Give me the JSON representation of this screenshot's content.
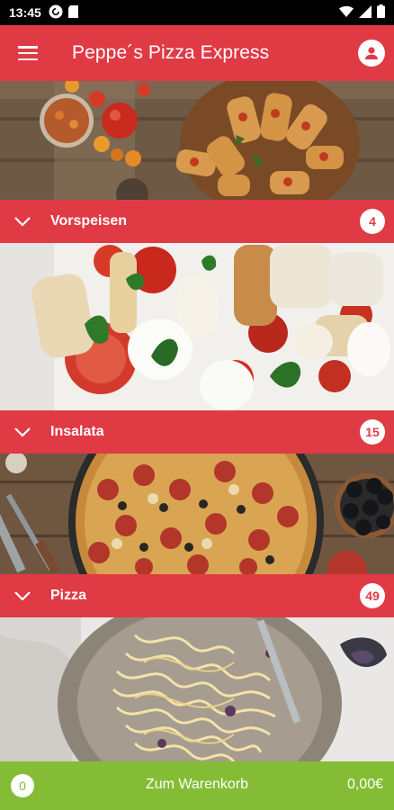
{
  "status_bar": {
    "time": "13:45",
    "icons_left": [
      "pocket-casts-icon",
      "sd-card-icon"
    ],
    "icons_right": [
      "wifi-icon",
      "signal-icon",
      "battery-icon"
    ]
  },
  "app_bar": {
    "title": "Peppe´s Pizza Express",
    "menu_icon": "hamburger-menu-icon",
    "account_icon": "account-icon"
  },
  "colors": {
    "primary": "#e03a45",
    "cart": "#84bd35"
  },
  "categories": [
    {
      "label": "Vorspeisen",
      "count": "4",
      "image": "bruschetta-photo"
    },
    {
      "label": "Insalata",
      "count": "15",
      "image": "caprese-salad-photo"
    },
    {
      "label": "Pizza",
      "count": "49",
      "image": "salami-pizza-photo"
    }
  ],
  "bottom_image": "spaghetti-photo",
  "cart": {
    "count": "0",
    "label": "Zum Warenkorb",
    "total": "0,00€"
  }
}
